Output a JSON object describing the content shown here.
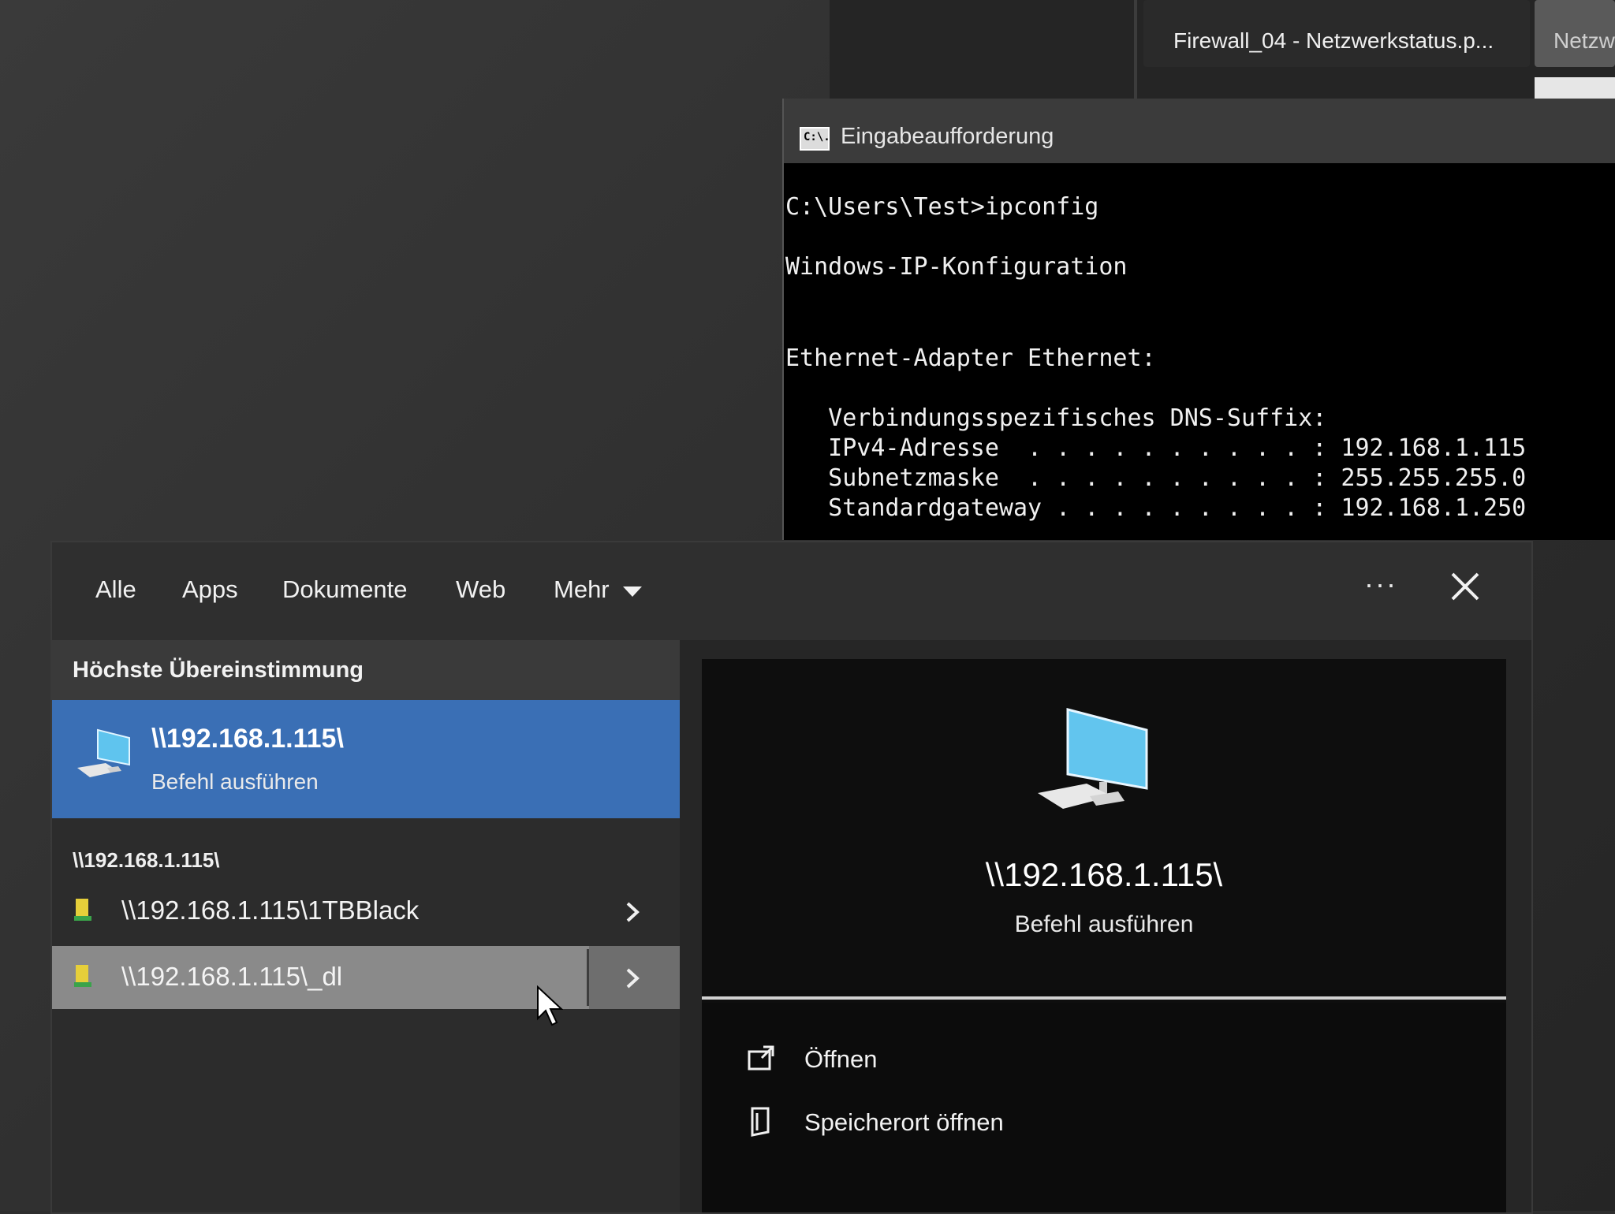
{
  "taskbar": {
    "thumb_1_label": "Firewall_04 - Netzwerkstatus.p...",
    "thumb_2_label": "Netzw"
  },
  "cmd": {
    "title": "Eingabeaufforderung",
    "icon_text": "C:\\.",
    "lines": [
      "C:\\Users\\Test>ipconfig",
      "Windows-IP-Konfiguration",
      "Ethernet-Adapter Ethernet:",
      "   Verbindungsspezifisches DNS-Suffix:",
      "   IPv4-Adresse  . . . . . . . . . . : 192.168.1.115",
      "   Subnetzmaske  . . . . . . . . . . : 255.255.255.0",
      "   Standardgateway . . . . . . . . . : 192.168.1.250"
    ]
  },
  "search": {
    "tabs": {
      "all": "Alle",
      "apps": "Apps",
      "docs": "Dokumente",
      "web": "Web",
      "more": "Mehr"
    },
    "more_options": "···",
    "section_header": "Höchste Übereinstimmung",
    "best_match": {
      "title": "\\\\192.168.1.115\\",
      "subtitle": "Befehl ausführen"
    },
    "sub_header": "\\\\192.168.1.115\\",
    "results": [
      {
        "label": "\\\\192.168.1.115\\1TBBlack"
      },
      {
        "label": "\\\\192.168.1.115\\_dl"
      }
    ],
    "preview": {
      "title": "\\\\192.168.1.115\\",
      "subtitle": "Befehl ausführen"
    },
    "actions": {
      "open": "Öffnen",
      "open_location": "Speicherort öffnen"
    }
  },
  "colors": {
    "accent": "#3a6fb5",
    "hover_row": "#8a8a8a",
    "panel_bg": "#1f1f1f"
  }
}
